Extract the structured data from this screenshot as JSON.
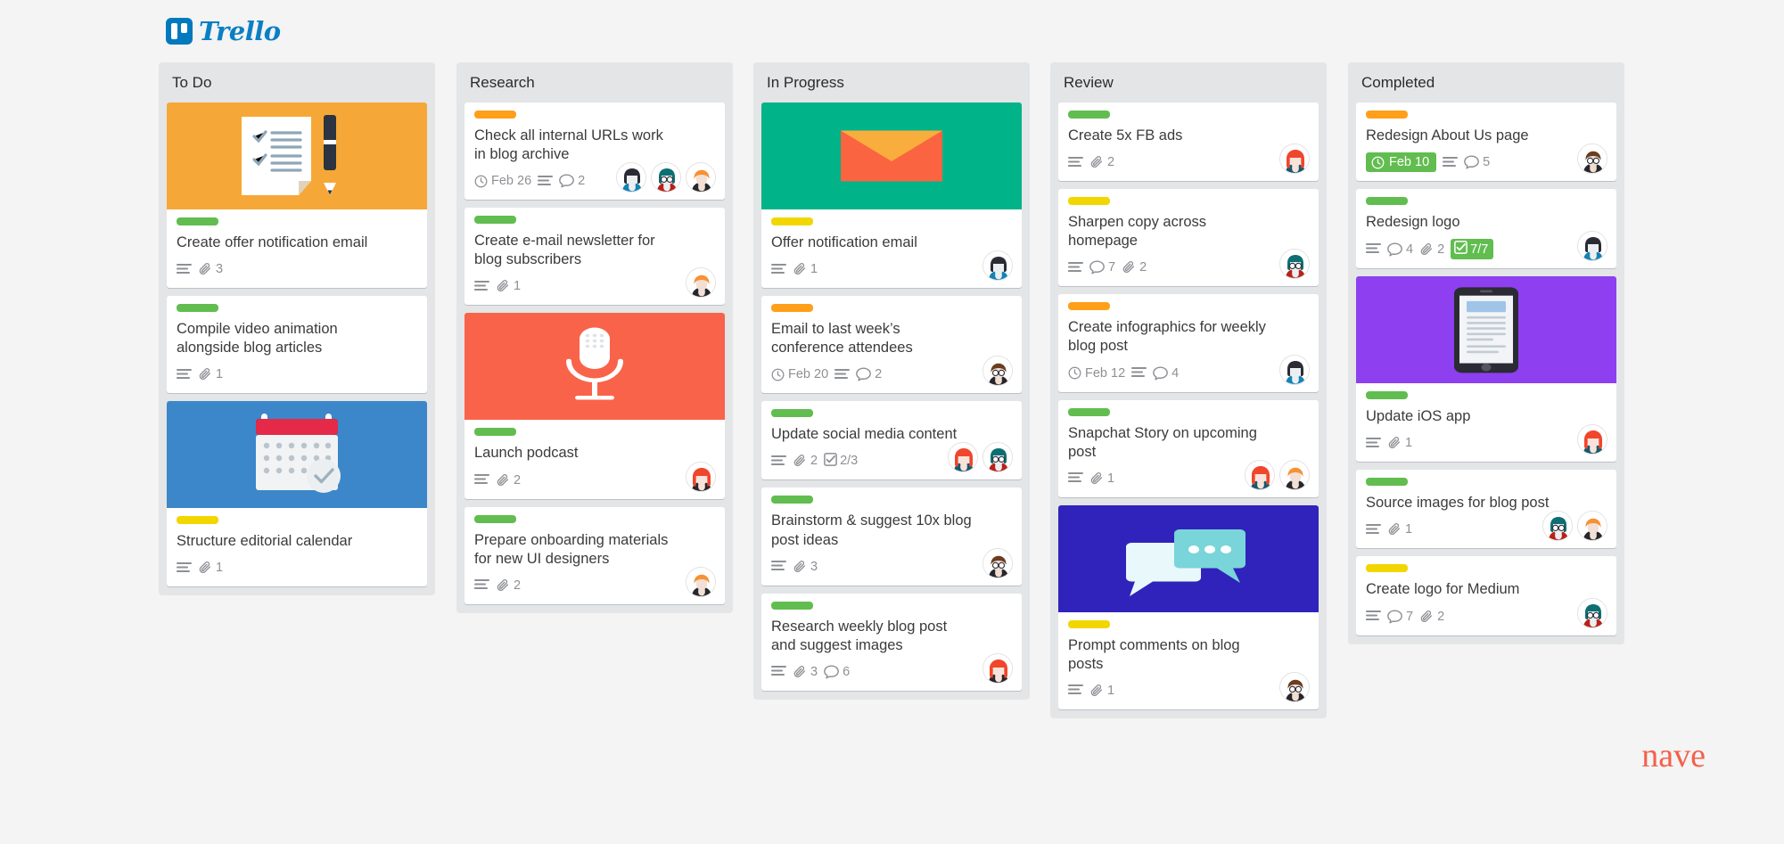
{
  "brand": {
    "trello_name": "Trello",
    "nave_name": "nave",
    "nave_color": "#f4604c",
    "trello_color": "#0079bf"
  },
  "label_colors": {
    "green": "#61bd4f",
    "yellow": "#f2d600",
    "orange": "#ff9f1a",
    "red": "#eb5a46"
  },
  "columns": [
    {
      "title": "To Do",
      "cards": [
        {
          "cover": "checklist-pen",
          "cover_bg": "#f5a837",
          "label": "green",
          "title": "Create offer notification email",
          "badges": [
            {
              "type": "description"
            },
            {
              "type": "attachment",
              "count": "3"
            }
          ],
          "avatars": []
        },
        {
          "label": "green",
          "title": "Compile video animation alongside blog articles",
          "badges": [
            {
              "type": "description"
            },
            {
              "type": "attachment",
              "count": "1"
            }
          ],
          "avatars": []
        },
        {
          "cover": "calendar-check",
          "cover_bg": "#3c87c9",
          "label": "yellow",
          "title": "Structure editorial calendar",
          "badges": [
            {
              "type": "description"
            },
            {
              "type": "attachment",
              "count": "1"
            }
          ],
          "avatars": []
        }
      ]
    },
    {
      "title": "Research",
      "cards": [
        {
          "label": "orange",
          "title": "Check all internal URLs work in blog archive",
          "badges": [
            {
              "type": "due",
              "text": "Feb 26",
              "highlight": false
            },
            {
              "type": "description"
            },
            {
              "type": "comment",
              "count": "2"
            }
          ],
          "avatars": [
            "dark-blue",
            "teal-glasses",
            "orange-black"
          ]
        },
        {
          "label": "green",
          "title": "Create e-mail newsletter for blog subscribers",
          "badges": [
            {
              "type": "description"
            },
            {
              "type": "attachment",
              "count": "1"
            }
          ],
          "avatars": [
            "orange-black"
          ]
        },
        {
          "cover": "microphone",
          "cover_bg": "#f9634a",
          "label": "green",
          "title": "Launch podcast",
          "badges": [
            {
              "type": "description"
            },
            {
              "type": "attachment",
              "count": "2"
            }
          ],
          "avatars": [
            "red-dark"
          ]
        },
        {
          "label": "green",
          "title": "Prepare onboarding materials for new UI designers",
          "badges": [
            {
              "type": "description"
            },
            {
              "type": "attachment",
              "count": "2"
            }
          ],
          "avatars": [
            "orange-black"
          ]
        }
      ]
    },
    {
      "title": "In Progress",
      "cards": [
        {
          "cover": "envelope",
          "cover_bg": "#00b388",
          "label": "yellow",
          "title": "Offer notification email",
          "badges": [
            {
              "type": "description"
            },
            {
              "type": "attachment",
              "count": "1"
            }
          ],
          "avatars": [
            "dark-blue"
          ]
        },
        {
          "label": "orange",
          "title": "Email to last week’s conference attendees",
          "badges": [
            {
              "type": "due",
              "text": "Feb 20",
              "highlight": false
            },
            {
              "type": "description"
            },
            {
              "type": "comment",
              "count": "2"
            }
          ],
          "avatars": [
            "brown-glasses"
          ]
        },
        {
          "label": "green",
          "title": "Update social media content",
          "badges": [
            {
              "type": "description"
            },
            {
              "type": "attachment",
              "count": "2"
            },
            {
              "type": "checklist",
              "text": "2/3",
              "complete": false
            }
          ],
          "avatars": [
            "red-hair",
            "teal-glasses"
          ]
        },
        {
          "label": "green",
          "title": "Brainstorm & suggest 10x blog post ideas",
          "badges": [
            {
              "type": "description"
            },
            {
              "type": "attachment",
              "count": "3"
            }
          ],
          "avatars": [
            "brown-glasses"
          ]
        },
        {
          "label": "green",
          "title": "Research weekly blog post and suggest images",
          "badges": [
            {
              "type": "description"
            },
            {
              "type": "attachment",
              "count": "3"
            },
            {
              "type": "comment",
              "count": "6"
            }
          ],
          "avatars": [
            "red-dark"
          ]
        }
      ]
    },
    {
      "title": "Review",
      "cards": [
        {
          "label": "green",
          "title": "Create 5x FB ads",
          "badges": [
            {
              "type": "description"
            },
            {
              "type": "attachment",
              "count": "2"
            }
          ],
          "avatars": [
            "red-hair"
          ]
        },
        {
          "label": "yellow",
          "title": "Sharpen copy across homepage",
          "badges": [
            {
              "type": "description"
            },
            {
              "type": "comment",
              "count": "7"
            },
            {
              "type": "attachment",
              "count": "2"
            }
          ],
          "avatars": [
            "teal-glasses"
          ]
        },
        {
          "label": "orange",
          "title": "Create infographics for weekly blog post",
          "badges": [
            {
              "type": "due",
              "text": "Feb 12",
              "highlight": false
            },
            {
              "type": "description"
            },
            {
              "type": "comment",
              "count": "4"
            }
          ],
          "avatars": [
            "dark-blue"
          ]
        },
        {
          "label": "green",
          "title": "Snapchat Story on upcoming post",
          "badges": [
            {
              "type": "description"
            },
            {
              "type": "attachment",
              "count": "1"
            }
          ],
          "avatars": [
            "red-hair",
            "orange-black"
          ]
        },
        {
          "cover": "speech-bubbles",
          "cover_bg": "#3023bb",
          "label": "yellow",
          "title": "Prompt comments on blog posts",
          "badges": [
            {
              "type": "description"
            },
            {
              "type": "attachment",
              "count": "1"
            }
          ],
          "avatars": [
            "brown-glasses"
          ]
        }
      ]
    },
    {
      "title": "Completed",
      "cards": [
        {
          "label": "orange",
          "title": "Redesign About Us page",
          "badges": [
            {
              "type": "due",
              "text": "Feb 10",
              "highlight": true
            },
            {
              "type": "description"
            },
            {
              "type": "comment",
              "count": "5"
            }
          ],
          "avatars": [
            "brown-glasses"
          ]
        },
        {
          "label": "green",
          "title": "Redesign logo",
          "badges": [
            {
              "type": "description"
            },
            {
              "type": "comment",
              "count": "4"
            },
            {
              "type": "attachment",
              "count": "2"
            },
            {
              "type": "checklist",
              "text": "7/7",
              "complete": true
            }
          ],
          "avatars": [
            "dark-blue"
          ]
        },
        {
          "cover": "phone",
          "cover_bg": "#8e3ff0",
          "label": "green",
          "title": "Update iOS app",
          "badges": [
            {
              "type": "description"
            },
            {
              "type": "attachment",
              "count": "1"
            }
          ],
          "avatars": [
            "red-hair"
          ]
        },
        {
          "label": "green",
          "title": "Source images for blog post",
          "badges": [
            {
              "type": "description"
            },
            {
              "type": "attachment",
              "count": "1"
            }
          ],
          "avatars": [
            "teal-glasses",
            "orange-black"
          ]
        },
        {
          "label": "yellow",
          "title": "Create logo for Medium",
          "badges": [
            {
              "type": "description"
            },
            {
              "type": "comment",
              "count": "7"
            },
            {
              "type": "attachment",
              "count": "2"
            }
          ],
          "avatars": [
            "teal-glasses"
          ]
        }
      ]
    }
  ]
}
